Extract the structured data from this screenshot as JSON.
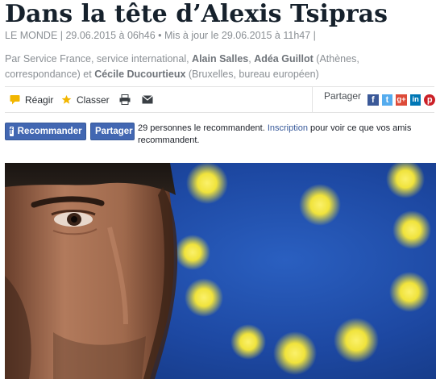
{
  "article": {
    "title": "Dans la tête d’Alexis Tsipras",
    "meta": "LE MONDE | 29.06.2015 à 06h46 • Mis à jour le 29.06.2015 à 11h47 |",
    "byline": {
      "prefix": "Par Service France, service international, ",
      "author1": "Alain Salles",
      "sep1": ", ",
      "author2": "Adéa Guillot",
      "mid": " (Athènes, correspondance) et ",
      "author3": "Cécile Ducourtieux",
      "suffix": " (Bruxelles, bureau européen)"
    }
  },
  "toolbar": {
    "react_label": "Réagir",
    "classer_label": "Classer",
    "share_label": "Partager",
    "icons": [
      "comment-icon",
      "star-icon",
      "print-icon",
      "email-icon"
    ],
    "social": [
      {
        "name": "facebook",
        "glyph": "f",
        "color": "#3b5998"
      },
      {
        "name": "twitter",
        "glyph": "t",
        "color": "#55acee"
      },
      {
        "name": "google-plus",
        "glyph": "g+",
        "color": "#dd4b39"
      },
      {
        "name": "linkedin",
        "glyph": "in",
        "color": "#0077b5"
      },
      {
        "name": "pinterest",
        "glyph": "p",
        "color": "#cb2027"
      }
    ]
  },
  "facebook": {
    "recommend_label": "Recommander",
    "share_label": "Partager",
    "count_text": "29 personnes le recommandent. ",
    "signup_link": "Inscription",
    "rest_text": " pour voir ce que vos amis recommandent."
  },
  "colors": {
    "headline": "#16212c",
    "meta": "#8a8f94",
    "accent_yellow": "#f2b600",
    "fb_blue": "#4267b2",
    "eu_blue": "#1f4fae",
    "eu_star": "#f5e43a"
  }
}
